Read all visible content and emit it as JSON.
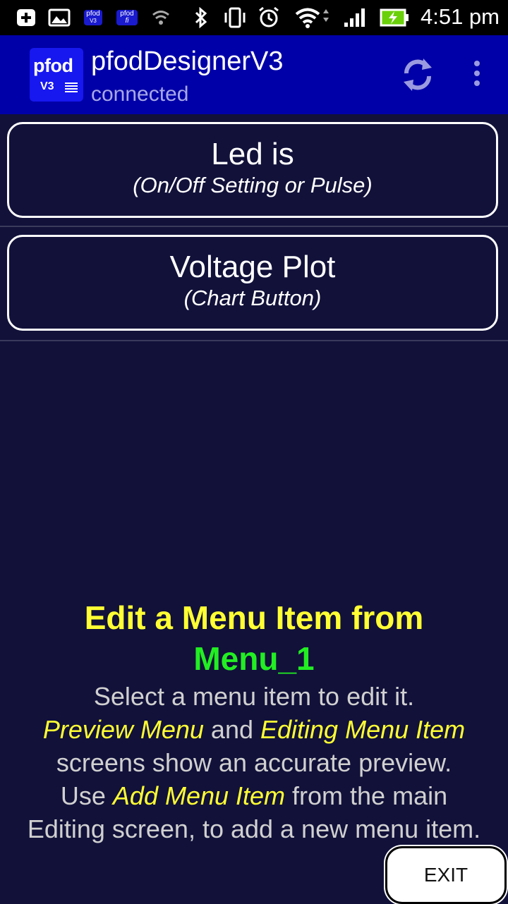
{
  "status_bar": {
    "time": "4:51 pm",
    "notif_badge_1": [
      "pfod",
      "V3"
    ],
    "notif_badge_2": [
      "pfod",
      "fi"
    ],
    "icons": [
      "add-box-icon",
      "image-icon",
      "pfod-v3-notification-icon",
      "pfodfi-notification-icon",
      "wifi-small-icon",
      "bluetooth-icon",
      "vibrate-icon",
      "alarm-icon",
      "wifi-icon",
      "signal-icon",
      "battery-charging-icon"
    ]
  },
  "app_bar": {
    "logo_top": "pfod",
    "logo_bottom": "V3",
    "title": "pfodDesignerV3",
    "subtitle": "connected",
    "actions": [
      "refresh-icon",
      "overflow-menu-icon"
    ]
  },
  "menu_items": [
    {
      "title": "Led is",
      "subtitle": "(On/Off Setting or Pulse)"
    },
    {
      "title": "Voltage Plot",
      "subtitle": "(Chart Button)"
    }
  ],
  "help": {
    "title": "Edit a Menu Item from",
    "menu_name": "Menu_1",
    "line1": "Select a menu item to edit it.",
    "line2_hl1": "Preview Menu",
    "line2_mid": " and ",
    "line2_hl2": "Editing Menu Item",
    "line3": "screens show an accurate preview.",
    "line4_pre": "Use ",
    "line4_hl": "Add Menu Item",
    "line4_post": " from the main",
    "line5": "Editing screen, to add a new menu item."
  },
  "exit_label": "EXIT",
  "colors": {
    "background": "#11113a",
    "app_bar": "#0000a8",
    "highlight_yellow": "#ffff33",
    "menu_name_green": "#22ee22",
    "help_text": "#d0d0d0"
  }
}
